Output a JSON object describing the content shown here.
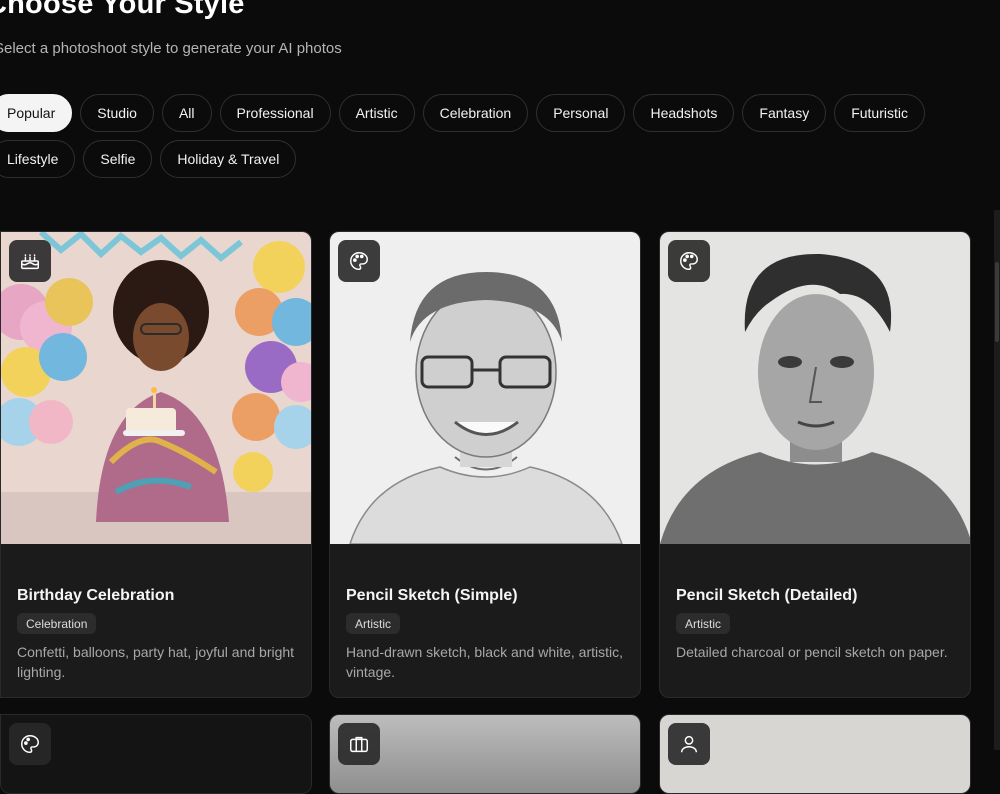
{
  "header": {
    "title": "Choose Your Style",
    "subtitle": "Select a photoshoot style to generate your AI photos"
  },
  "filters": {
    "selected": "Popular",
    "items": [
      "Popular",
      "Studio",
      "All",
      "Professional",
      "Artistic",
      "Celebration",
      "Personal",
      "Headshots",
      "Fantasy",
      "Futuristic",
      "Lifestyle",
      "Selfie",
      "Holiday & Travel"
    ]
  },
  "cards": [
    {
      "title": "Birthday Celebration",
      "tag": "Celebration",
      "description": "Confetti, balloons, party hat, joyful and bright lighting.",
      "icon": "cake-icon"
    },
    {
      "title": "Pencil Sketch (Simple)",
      "tag": "Artistic",
      "description": "Hand-drawn sketch, black and white, artistic, vintage.",
      "icon": "palette-icon"
    },
    {
      "title": "Pencil Sketch (Detailed)",
      "tag": "Artistic",
      "description": "Detailed charcoal or pencil sketch on paper.",
      "icon": "palette-icon"
    }
  ],
  "next_row_icons": [
    "palette-icon",
    "briefcase-icon",
    "person-icon"
  ],
  "colors": {
    "background": "#0b0b0b",
    "card": "#1b1b1b",
    "active_chip": "#f4f4f4"
  }
}
